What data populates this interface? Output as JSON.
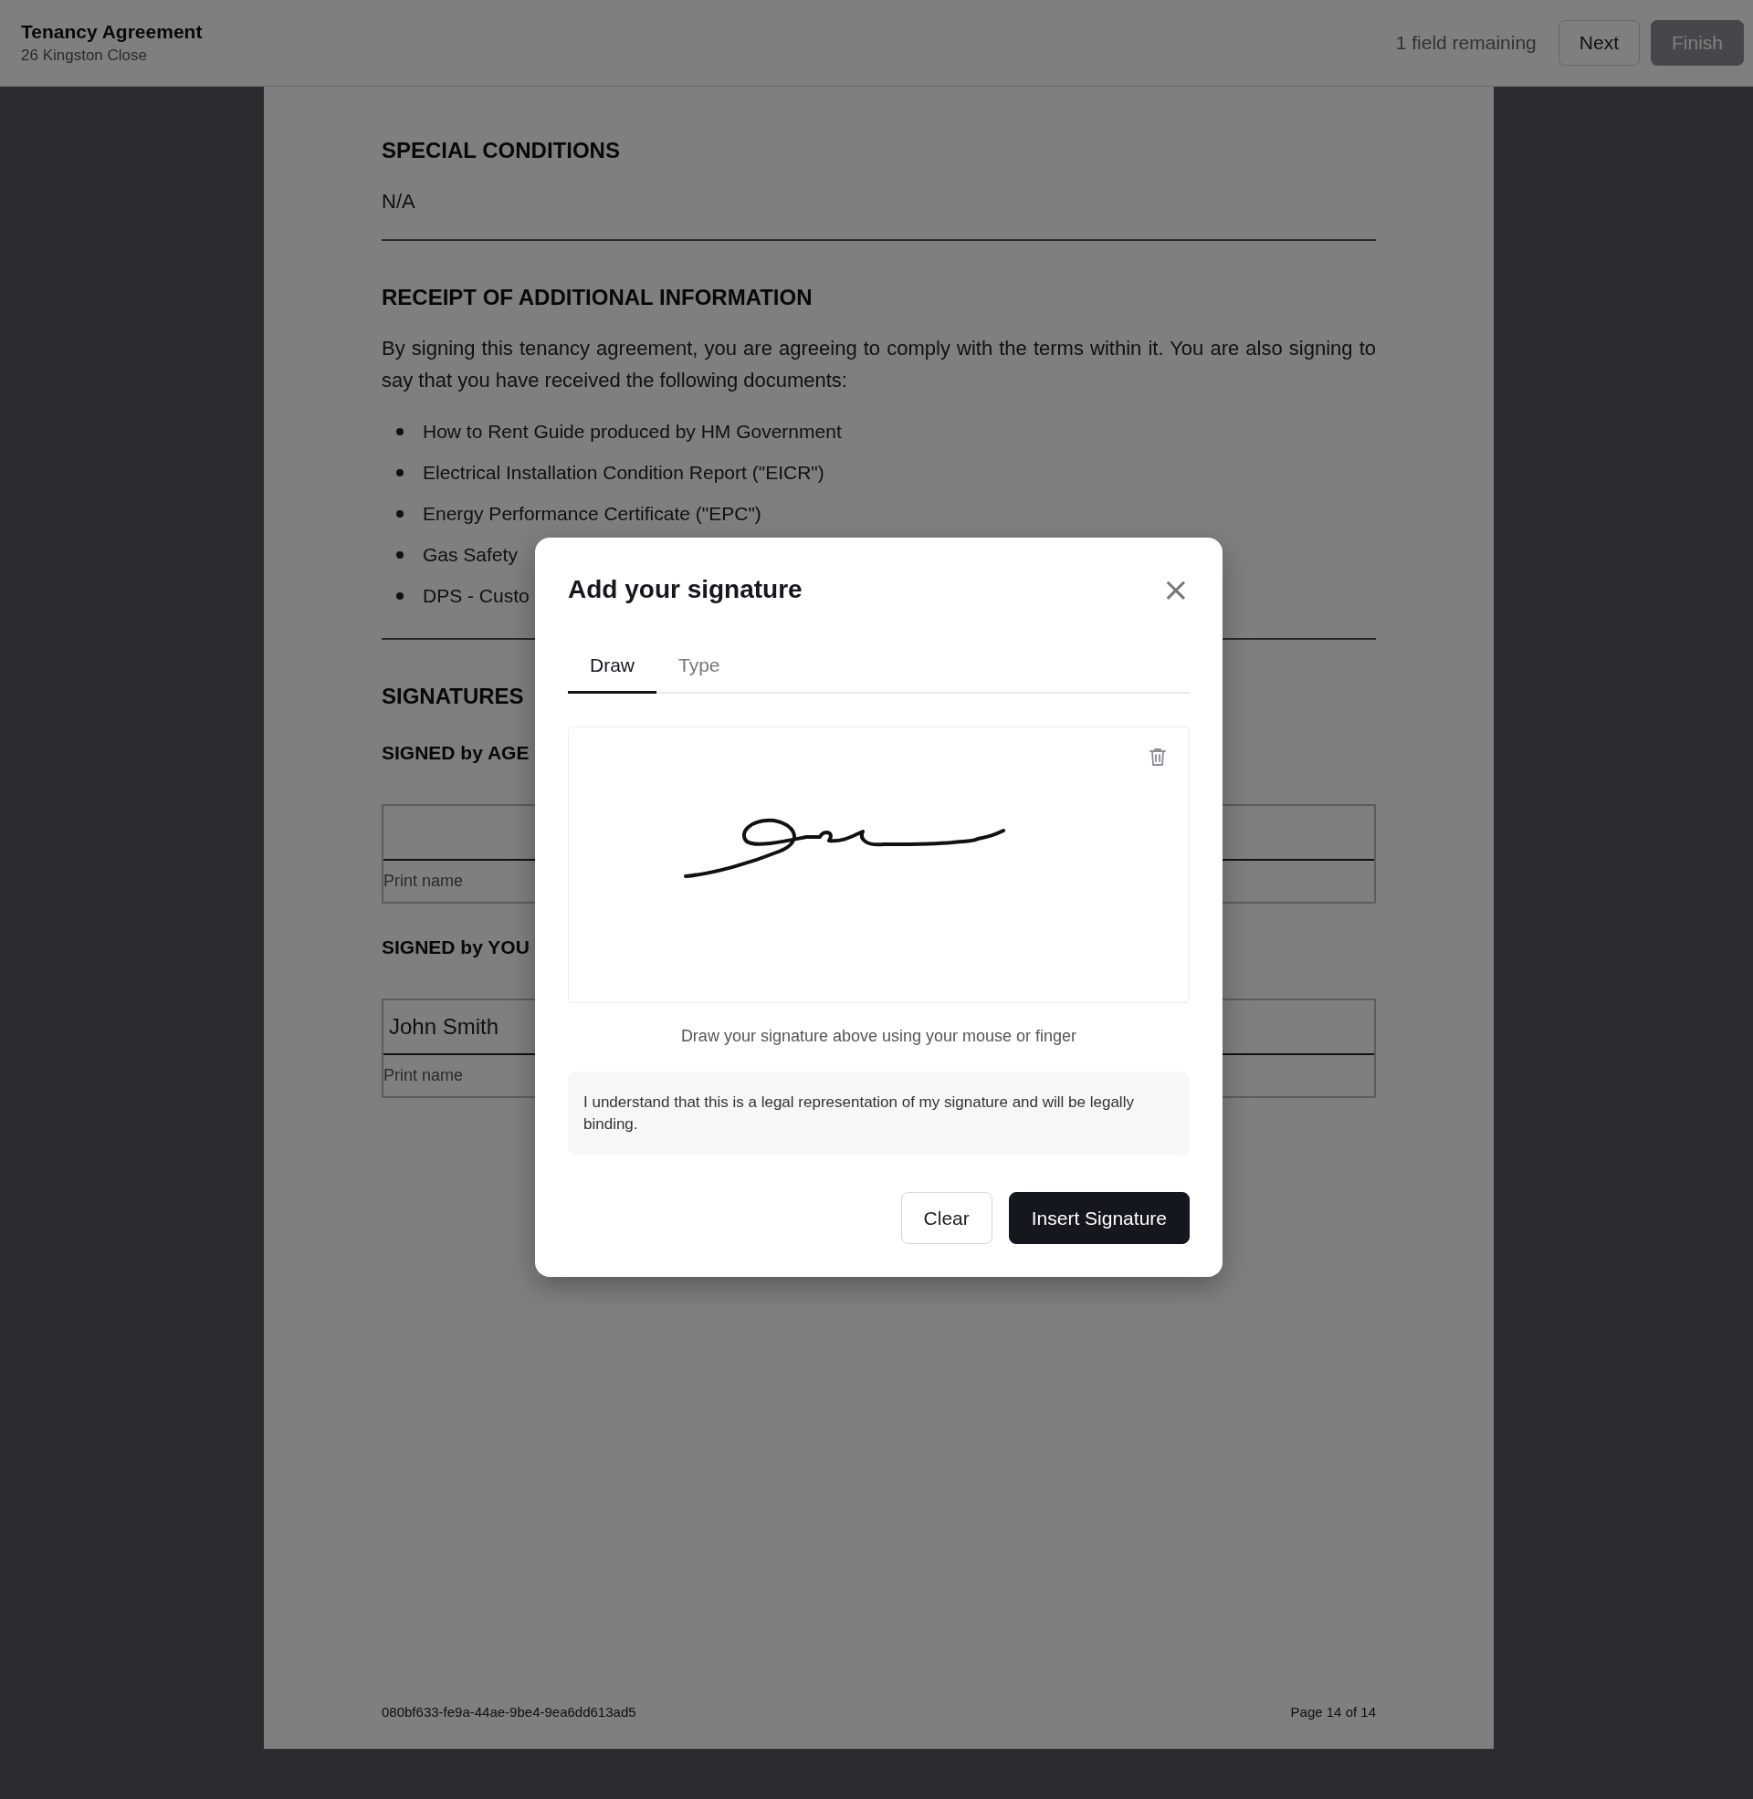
{
  "header": {
    "title": "Tenancy Agreement",
    "subtitle": "26 Kingston Close",
    "remaining": "1 field remaining",
    "buttons": [
      {
        "label": "Next",
        "kind": "outline",
        "disabled": false
      },
      {
        "label": "Finish",
        "kind": "primary",
        "disabled": true
      }
    ]
  },
  "document": {
    "blocks": [
      {
        "kind": "heading",
        "text": "SPECIAL CONDITIONS"
      },
      {
        "kind": "text",
        "text": "N/A"
      },
      {
        "kind": "rule"
      },
      {
        "kind": "heading",
        "text": "RECEIPT OF ADDITIONAL INFORMATION"
      },
      {
        "kind": "text",
        "text": "By signing this tenancy agreement, you are agreeing to comply with the terms within it. You are also signing to say that you have received the following documents:"
      },
      {
        "kind": "bullets",
        "items": [
          "How to Rent Guide produced by HM Government",
          "Electrical Installation Condition Report (\"EICR\")",
          "Energy Performance Certificate (\"EPC\")",
          "Gas Safety",
          "DPS - Custo"
        ]
      },
      {
        "kind": "rule"
      },
      {
        "kind": "heading",
        "text": "SIGNATURES"
      },
      {
        "kind": "subheading",
        "text": "SIGNED by AGE"
      },
      {
        "kind": "signature_field",
        "label": "Print name"
      },
      {
        "kind": "subheading",
        "text": "SIGNED by YOU"
      },
      {
        "kind": "signature_field",
        "value": "John Smith",
        "label": "Print name"
      }
    ],
    "footer": {
      "id": "080bf633-fe9a-44ae-9be4-9ea6dd613ad5",
      "page": "Page 14 of 14"
    }
  },
  "modal": {
    "title": "Add your signature",
    "close": "×",
    "tabs": [
      {
        "label": "Draw",
        "selected": true
      },
      {
        "label": "Type",
        "selected": false
      }
    ],
    "hint": "Draw your signature above using your mouse or finger",
    "notice": "I understand that this is a legal representation of my signature and will be legally binding.",
    "buttons": [
      {
        "label": "Clear",
        "kind": "outline"
      },
      {
        "label": "Insert Signature",
        "kind": "primary"
      }
    ]
  }
}
